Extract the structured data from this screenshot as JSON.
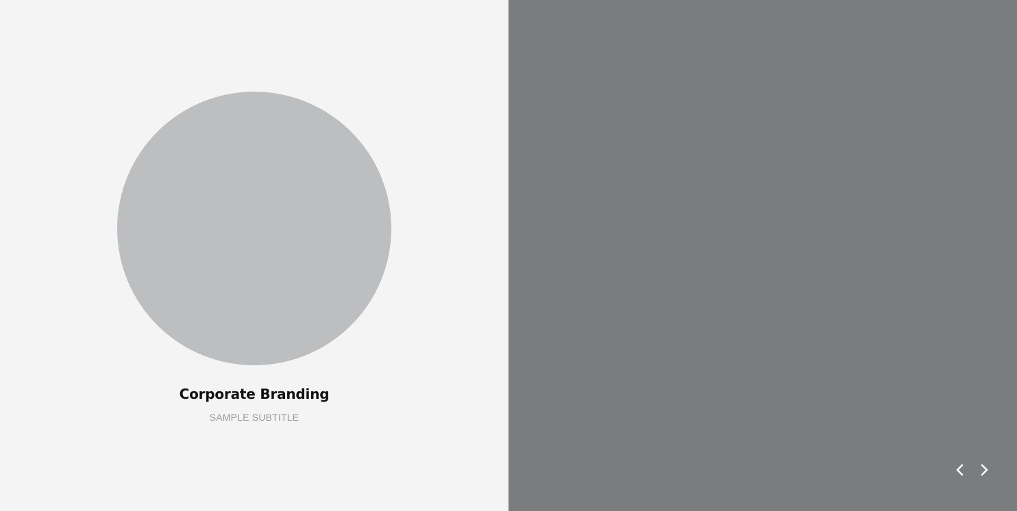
{
  "portfolio": {
    "title": "Corporate Branding",
    "subtitle": "SAMPLE SUBTITLE"
  },
  "slider": {
    "prev_icon": "chevron-left-icon",
    "next_icon": "chevron-right-icon"
  },
  "colors": {
    "left_background": "#f4f4f4",
    "placeholder_circle": "#bdbebf",
    "right_background": "#7b7c7e",
    "title_text": "#111111",
    "subtitle_text": "#9a9a9a",
    "nav_arrows": "#ffffff"
  }
}
